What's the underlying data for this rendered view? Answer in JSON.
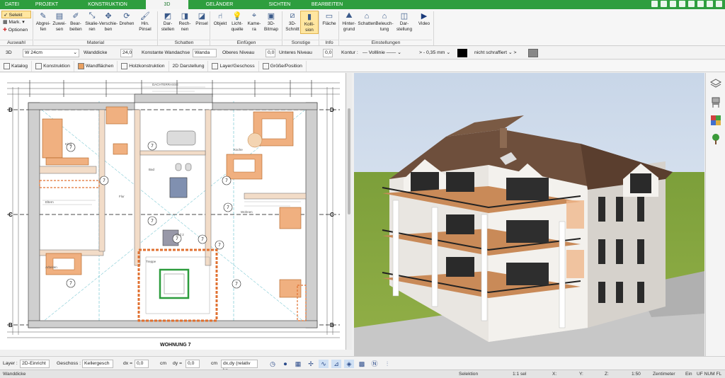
{
  "menu": {
    "tabs": [
      {
        "label": "DATEI",
        "active": false
      },
      {
        "label": "PROJEKT",
        "active": false
      },
      {
        "label": "KONSTRUKTION",
        "active": false
      },
      {
        "label": "3D",
        "active": true
      },
      {
        "label": "GELÄNDER",
        "active": false
      },
      {
        "label": "SICHTEN",
        "active": false
      },
      {
        "label": "BEARBEITEN",
        "active": false
      }
    ]
  },
  "ribbon": {
    "auswahl": {
      "selekt": "Selekt",
      "mark": "Mark.",
      "optionen": "Optionen",
      "group": "Auswahl"
    },
    "buttons": [
      {
        "label": "Abgrei-\nfen",
        "icon": "eyedropper-icon"
      },
      {
        "label": "Zuwei-\nsen",
        "icon": "paint-assign-icon"
      },
      {
        "label": "Bear-\nbeiten",
        "icon": "edit-pen-icon"
      },
      {
        "label": "Skalie-\nren",
        "icon": "scale-icon"
      },
      {
        "label": "Verschie-\nben",
        "icon": "move-icon"
      },
      {
        "label": "Drehen",
        "icon": "rotate-icon"
      },
      {
        "label": "Hin.\nPinsel",
        "icon": "brush-icon"
      },
      {
        "label": "Dar-\nstellen",
        "icon": "shadow-display-icon"
      },
      {
        "label": "Rech-\nnen",
        "icon": "shadow-compute-icon"
      },
      {
        "label": "Pinsel",
        "icon": "shadow-brush-icon"
      },
      {
        "label": "Objekt",
        "icon": "chair-icon"
      },
      {
        "label": "Licht-\nquelle",
        "icon": "lightbulb-icon"
      },
      {
        "label": "Kame-\nra",
        "icon": "camera-icon"
      },
      {
        "label": "3D-\nBitmap",
        "icon": "bitmap-icon"
      },
      {
        "label": "3D-\nSchnitt",
        "icon": "section-icon"
      },
      {
        "label": "Kolli-\nsion",
        "icon": "collision-icon"
      },
      {
        "label": "Fläche",
        "icon": "area-icon"
      },
      {
        "label": "Hinter-\ngrund",
        "icon": "background-icon"
      },
      {
        "label": "Schatten",
        "icon": "house-shadow-icon"
      },
      {
        "label": "Beleuch-\ntung",
        "icon": "house-light-icon"
      },
      {
        "label": "Dar-\nstellung",
        "icon": "display-mode-icon"
      },
      {
        "label": "Video",
        "icon": "video-play-icon"
      }
    ],
    "groups": [
      "Material",
      "Schatten",
      "Einfügen",
      "Sonstige",
      "Info",
      "Einstellungen"
    ]
  },
  "props": {
    "mode": "3D",
    "wall_type": "W 24cm",
    "wanddicke_label": "Wanddicke",
    "wanddicke_value": "24,0",
    "wandachse_label": "Konstante Wandachse",
    "wandachse_value": "Wanda",
    "oberes_label": "Oberes Niveau",
    "oberes_value": "0,0",
    "unteres_label": "Unteres Niveau",
    "unteres_value": "0,0",
    "kontur_label": "Kontur :",
    "kontur_line": "Volllinie",
    "thickness": "0,35 mm",
    "hatch": "nicht schraffiert"
  },
  "tabs": [
    "Katalog",
    "Konstruktion",
    "Wandflächen",
    "Holzkonstruktion",
    "2D Darstellung",
    "Layer/Geschoss",
    "Größe/Position"
  ],
  "plan": {
    "axis_left": [
      "D",
      "C",
      "B"
    ],
    "axis_right": [
      "D",
      "C",
      "B"
    ],
    "room_title": "WOHNUNG 7",
    "top_label": "DACHTERRASSE",
    "rooms": [
      "Kind",
      "Bad",
      "Flur",
      "Eltern",
      "Wohnen",
      "Küche",
      "Arbeiten",
      "Bad 2",
      "Treppe"
    ],
    "marker": "7"
  },
  "bottom": {
    "layer_label": "Layer :",
    "layer_value": "2D-Einricht",
    "geschoss_label": "Geschoss :",
    "geschoss_value": "Kellergesch",
    "dx_label": "dx =",
    "dx_value": "0,0",
    "dx_unit": "cm",
    "dy_label": "dy =",
    "dy_value": "0,0",
    "dy_unit": "cm",
    "mode": "dx,dy (relativ ka"
  },
  "status": {
    "left": "Wanddicke",
    "selektion": "Selektion",
    "scale": "1:1 sel",
    "x": "X:",
    "y": "Y:",
    "z": "Z:",
    "ratio": "1:50",
    "unit": "Zentimeter",
    "ein": "Ein",
    "flags": "UF  NUM  FL"
  },
  "colors": {
    "brand": "#2e9e3e",
    "accent": "#f0a060",
    "wall_fill": "#f2dcc8",
    "sky": "#d8e4f1",
    "grass": "#7c9f3a"
  }
}
